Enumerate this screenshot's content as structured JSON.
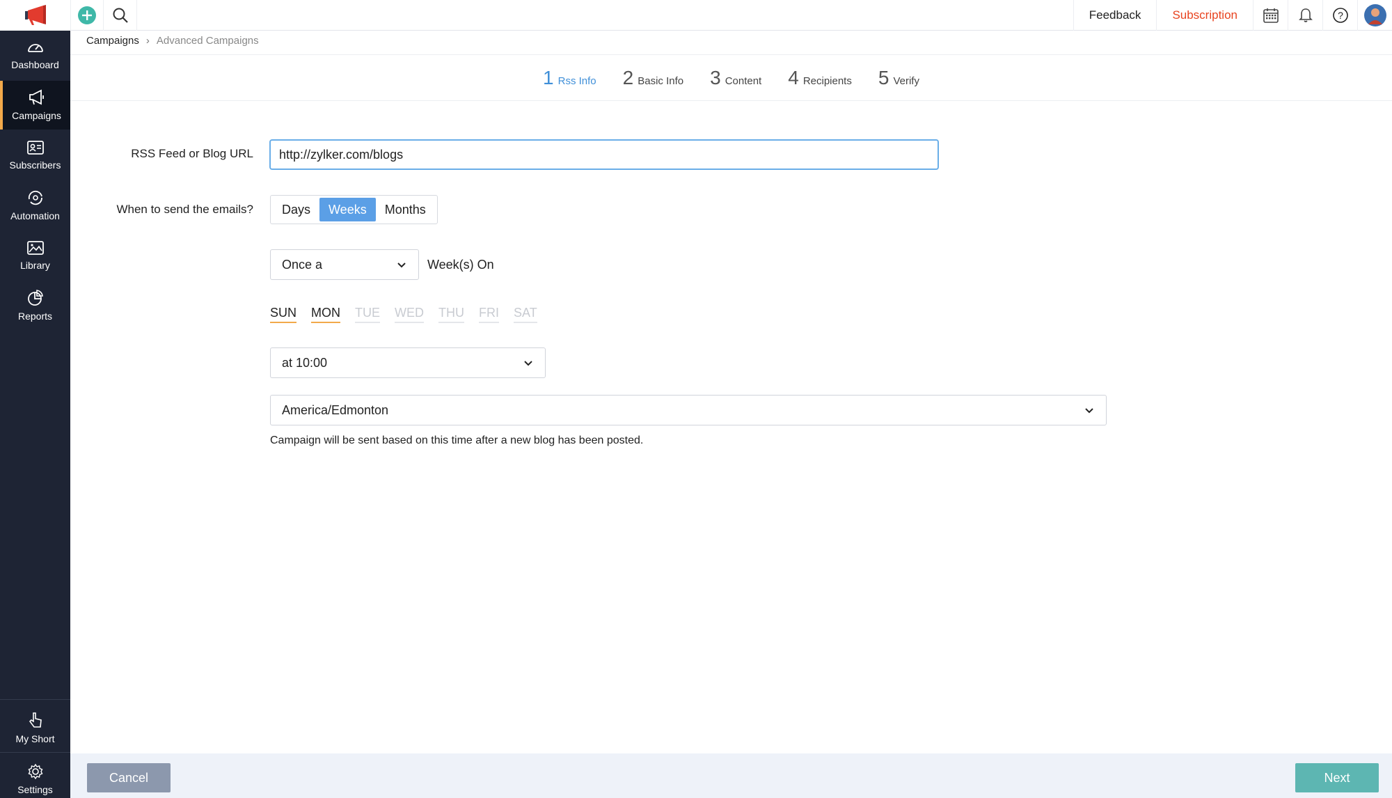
{
  "topbar": {
    "logo_icon": "megaphone-logo-icon",
    "add_icon": "plus-circle-icon",
    "search_icon": "search-icon",
    "feedback_label": "Feedback",
    "subscription_label": "Subscription",
    "calendar_icon": "calendar-icon",
    "bell_icon": "bell-icon",
    "help_icon": "help-icon",
    "avatar_icon": "user-avatar"
  },
  "sidebar": {
    "items": [
      {
        "label": "Dashboard",
        "icon": "dashboard-icon"
      },
      {
        "label": "Campaigns",
        "icon": "megaphone-icon"
      },
      {
        "label": "Subscribers",
        "icon": "subscribers-icon"
      },
      {
        "label": "Automation",
        "icon": "automation-icon"
      },
      {
        "label": "Library",
        "icon": "library-icon"
      },
      {
        "label": "Reports",
        "icon": "reports-icon"
      }
    ],
    "bottom_items": [
      {
        "label": "My Short",
        "icon": "pointer-icon"
      },
      {
        "label": "Settings",
        "icon": "gear-icon"
      }
    ]
  },
  "breadcrumb": {
    "root": "Campaigns",
    "separator": "›",
    "current": "Advanced Campaigns"
  },
  "steps": [
    {
      "num": "1",
      "name": "Rss Info",
      "active": true
    },
    {
      "num": "2",
      "name": "Basic Info"
    },
    {
      "num": "3",
      "name": "Content"
    },
    {
      "num": "4",
      "name": "Recipients"
    },
    {
      "num": "5",
      "name": "Verify"
    }
  ],
  "form": {
    "url_label": "RSS Feed or Blog URL",
    "url_value": "http://zylker.com/blogs",
    "when_label": "When to send the emails?",
    "frequency_options": [
      "Days",
      "Weeks",
      "Months"
    ],
    "frequency_selected": "Weeks",
    "interval_value": "Once a",
    "interval_suffix": "Week(s) On",
    "days": [
      {
        "label": "SUN",
        "selected": true
      },
      {
        "label": "MON",
        "selected": true
      },
      {
        "label": "TUE",
        "selected": false
      },
      {
        "label": "WED",
        "selected": false
      },
      {
        "label": "THU",
        "selected": false
      },
      {
        "label": "FRI",
        "selected": false
      },
      {
        "label": "SAT",
        "selected": false
      }
    ],
    "time_value": "at 10:00",
    "timezone_value": "America/Edmonton",
    "hint": "Campaign will be sent based on this time after a new blog has been posted."
  },
  "footer": {
    "cancel_label": "Cancel",
    "next_label": "Next"
  },
  "colors": {
    "accent_blue": "#5b9fe6",
    "subscription_red": "#e8431f",
    "active_day_underline": "#f2a94a",
    "sidebar_bg": "#1e2434",
    "next_button": "#5db6b2",
    "cancel_button": "#8c98ad"
  }
}
